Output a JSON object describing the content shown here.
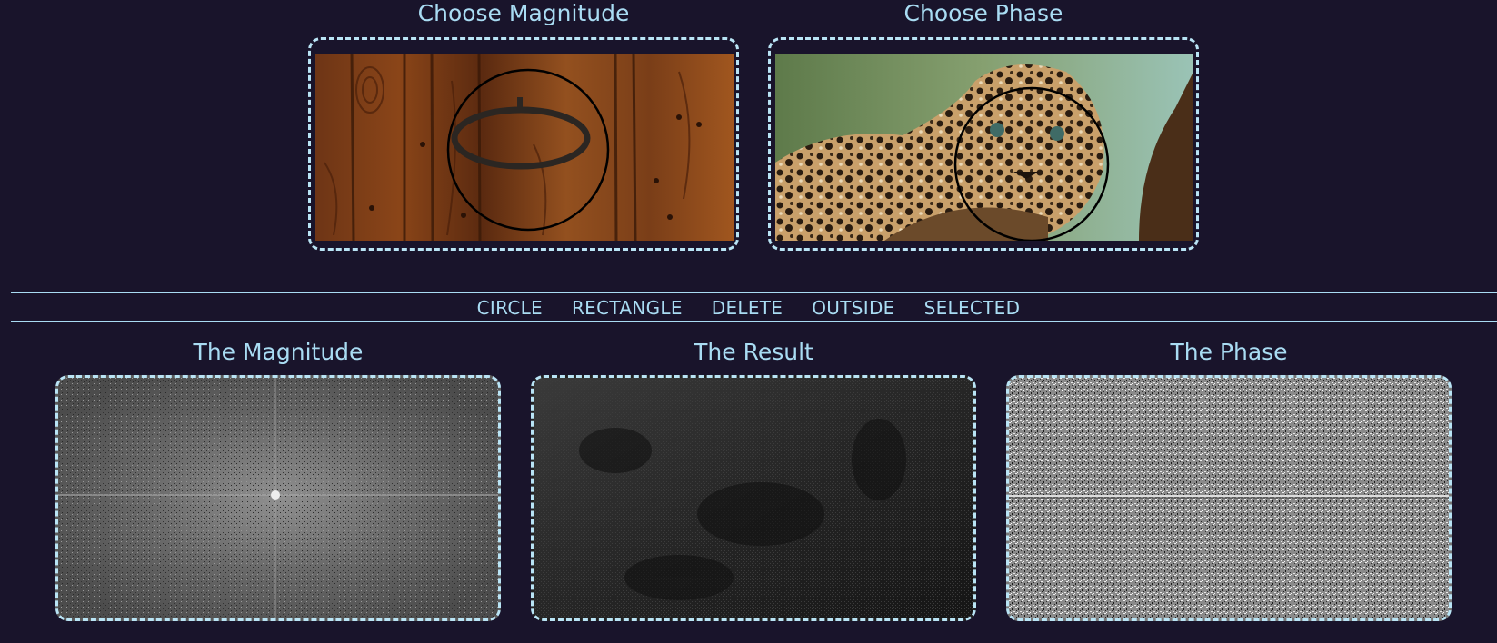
{
  "top": {
    "magnitude_title": "Choose Magnitude",
    "phase_title": "Choose Phase"
  },
  "toolbar": {
    "circle": "CIRCLE",
    "rectangle": "RECTANGLE",
    "delete": "DELETE",
    "outside": "OUTSIDE",
    "selected": "SELECTED"
  },
  "bottom": {
    "magnitude_title": "The Magnitude",
    "result_title": "The Result",
    "phase_title": "The Phase"
  },
  "colors": {
    "background": "#19142b",
    "accent": "#a9dcf3"
  }
}
